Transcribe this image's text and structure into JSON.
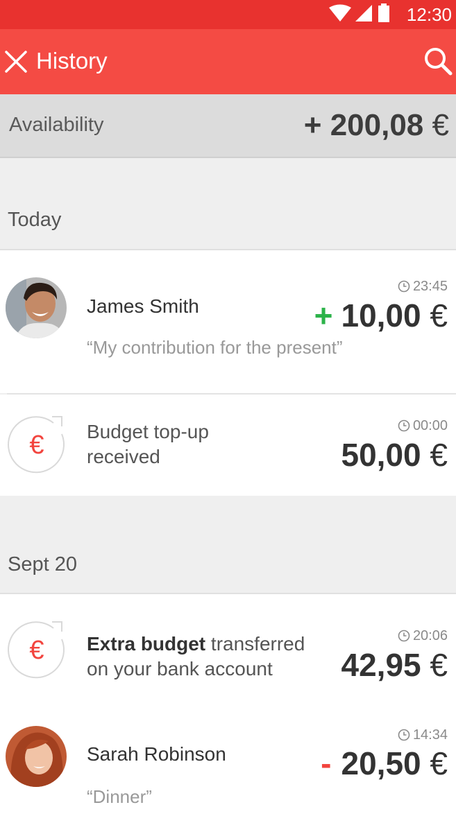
{
  "status_bar": {
    "time": "12:30"
  },
  "app_bar": {
    "title": "History"
  },
  "availability": {
    "label": "Availability",
    "sign": "+",
    "amount": "200,08",
    "currency": "€"
  },
  "sections": [
    {
      "label": "Today",
      "items": [
        {
          "type": "person",
          "name": "James Smith",
          "note": "“My contribution for the present”",
          "time": "23:45",
          "sign": "+",
          "amount": "10,00",
          "currency": "€"
        },
        {
          "type": "budget",
          "line1": "Budget top-up",
          "line2": "received",
          "time": "00:00",
          "amount": "50,00",
          "currency": "€"
        }
      ]
    },
    {
      "label": "Sept 20",
      "items": [
        {
          "type": "budget",
          "line1_bold": "Extra budget",
          "line1_rest": "transferred",
          "line2": "on your bank account",
          "time": "20:06",
          "amount": "42,95",
          "currency": "€"
        },
        {
          "type": "person",
          "name": "Sarah Robinson",
          "note": "“Dinner”",
          "time": "14:34",
          "sign": "-",
          "amount": "20,50",
          "currency": "€"
        }
      ]
    }
  ],
  "colors": {
    "status_bar": "#e8322f",
    "app_bar": "#f44b44",
    "positive": "#2cb34a",
    "negative": "#f2443e",
    "euro_icon": "#f2443e"
  },
  "icons": [
    "wifi-icon",
    "signal-icon",
    "battery-icon",
    "close-icon",
    "search-icon",
    "clock-icon",
    "euro-refresh-icon"
  ]
}
